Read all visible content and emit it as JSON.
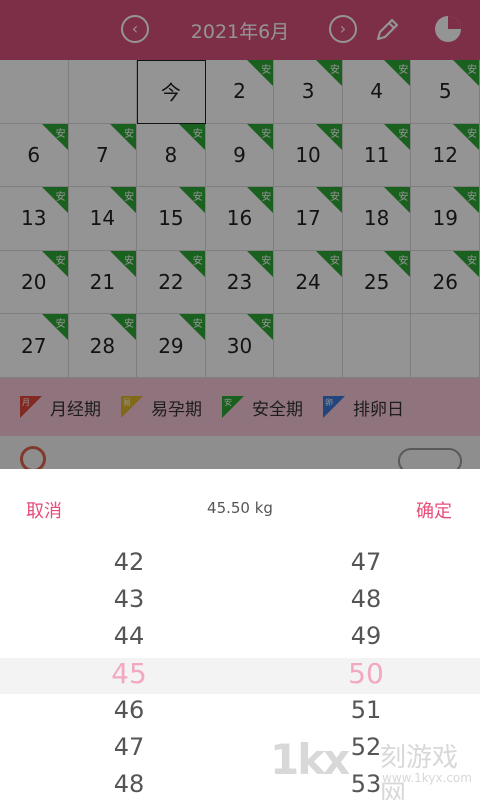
{
  "header": {
    "title": "2021年6月",
    "prev_icon": "chevron-left-icon",
    "next_icon": "chevron-right-icon",
    "edit_icon": "pencil-icon",
    "stats_icon": "pie-chart-icon",
    "color": "#d9527d"
  },
  "calendar": {
    "tag_text": "安",
    "tag_color": "#2ea836",
    "today_label": "今",
    "rows": [
      [
        "",
        "",
        "今",
        "2",
        "3",
        "4",
        "5"
      ],
      [
        "6",
        "7",
        "8",
        "9",
        "10",
        "11",
        "12"
      ],
      [
        "13",
        "14",
        "15",
        "16",
        "17",
        "18",
        "19"
      ],
      [
        "20",
        "21",
        "22",
        "23",
        "24",
        "25",
        "26"
      ],
      [
        "27",
        "28",
        "29",
        "30",
        "",
        "",
        ""
      ]
    ]
  },
  "legend": [
    {
      "label": "月经期",
      "icon_char": "月",
      "color": "#e0473b"
    },
    {
      "label": "易孕期",
      "icon_char": "易",
      "color": "#e1b52b"
    },
    {
      "label": "安全期",
      "icon_char": "安",
      "color": "#2ea836"
    },
    {
      "label": "排卵日",
      "icon_char": "卵",
      "color": "#3a77d6"
    }
  ],
  "picker": {
    "cancel": "取消",
    "title": "45.50 kg",
    "confirm": "确定",
    "integer_column": [
      "42",
      "43",
      "44",
      "45",
      "46",
      "47",
      "48"
    ],
    "decimal_column": [
      "47",
      "48",
      "49",
      "50",
      "51",
      "52",
      "53"
    ],
    "selected_integer": "45",
    "selected_decimal": "50",
    "accent_color": "#e74d78"
  },
  "watermark": {
    "logo": "1kx",
    "name": "刻游戏网",
    "url": "www.1kyx.com"
  }
}
